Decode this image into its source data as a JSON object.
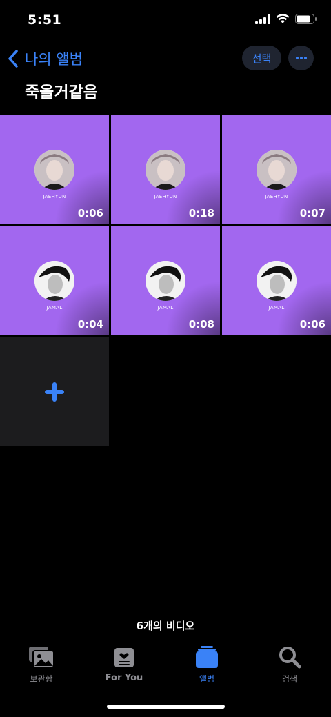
{
  "status": {
    "time": "5:51"
  },
  "nav": {
    "back_label": "나의 앨범",
    "select_label": "선택"
  },
  "album": {
    "title": "죽을거같음"
  },
  "videos": [
    {
      "name": "JAEHYUN",
      "duration": "0:06"
    },
    {
      "name": "JAEHYUN",
      "duration": "0:18"
    },
    {
      "name": "JAEHYUN",
      "duration": "0:07"
    },
    {
      "name": "JAMAL",
      "duration": "0:04"
    },
    {
      "name": "JAMAL",
      "duration": "0:08"
    },
    {
      "name": "JAMAL",
      "duration": "0:06"
    }
  ],
  "footer": {
    "count_label": "6개의 비디오"
  },
  "tabs": [
    {
      "label": "보관함",
      "icon": "library-icon"
    },
    {
      "label": "For You",
      "icon": "for-you-icon"
    },
    {
      "label": "앨범",
      "icon": "albums-icon"
    },
    {
      "label": "검색",
      "icon": "search-icon"
    }
  ],
  "colors": {
    "accent": "#3a82f7",
    "tile": "#a267ef"
  }
}
